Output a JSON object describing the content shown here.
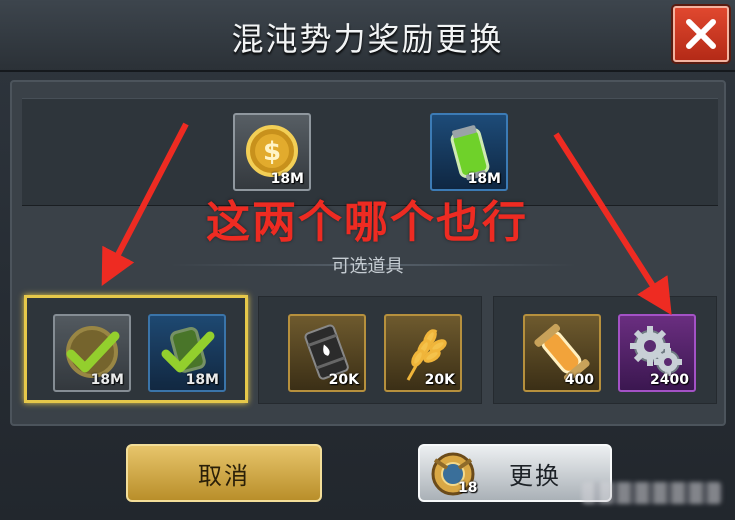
{
  "dialog": {
    "title": "混沌势力奖励更换",
    "close_icon": "close-x-icon",
    "section_label": "可选道具",
    "annotation": "这两个哪个也行"
  },
  "top_rewards": [
    {
      "icon": "gold-coin-icon",
      "qty": "18M",
      "frame": "gray"
    },
    {
      "icon": "green-canister-icon",
      "qty": "18M",
      "frame": "blue"
    }
  ],
  "option_groups": [
    {
      "selected": true,
      "items": [
        {
          "icon": "gold-coin-icon",
          "qty": "18M",
          "checked": true
        },
        {
          "icon": "green-canister-icon",
          "qty": "18M",
          "checked": true
        }
      ]
    },
    {
      "selected": false,
      "items": [
        {
          "icon": "oil-barrel-icon",
          "qty": "20K"
        },
        {
          "icon": "wheat-icon",
          "qty": "20K"
        }
      ]
    },
    {
      "selected": false,
      "items": [
        {
          "icon": "fuel-capsule-icon",
          "qty": "400"
        },
        {
          "icon": "gears-icon",
          "qty": "2400"
        }
      ]
    }
  ],
  "buttons": {
    "cancel_label": "取消",
    "exchange_label": "更换",
    "exchange_cost": "18",
    "exchange_cost_icon": "chaos-badge-icon"
  },
  "colors": {
    "accent_gold": "#e6c84a",
    "annotation_red": "#ee2b22",
    "close_red": "#c9341f"
  }
}
